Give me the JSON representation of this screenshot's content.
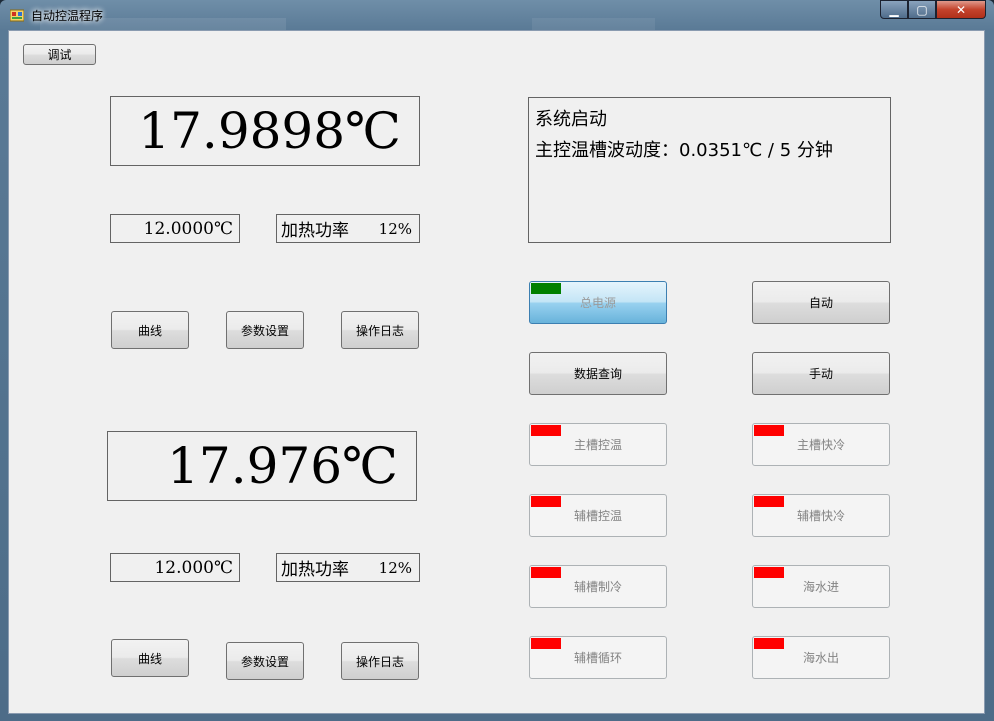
{
  "window": {
    "title": "自动控温程序",
    "controls": {
      "minimize": "▁",
      "maximize": "▢",
      "close": "✕"
    }
  },
  "toolbar": {
    "debug_label": "调试"
  },
  "channel1": {
    "temperature": "17.9898℃",
    "setpoint": "12.0000℃",
    "power_label": "加热功率",
    "power_value": "12%",
    "buttons": {
      "curve": "曲线",
      "params": "参数设置",
      "log": "操作日志"
    }
  },
  "channel2": {
    "temperature": "17.976℃",
    "setpoint": "12.000℃",
    "power_label": "加热功率",
    "power_value": "12%",
    "buttons": {
      "curve": "曲线",
      "params": "参数设置",
      "log": "操作日志"
    }
  },
  "status": {
    "lines": [
      "系统启动",
      "主控温槽波动度：0.0351℃ / 5 分钟"
    ]
  },
  "controls": {
    "main_power": "总电源",
    "auto": "自动",
    "data_query": "数据查询",
    "manual": "手动",
    "main_temp_control": "主槽控温",
    "main_fast_cool": "主槽快冷",
    "aux_temp_control": "辅槽控温",
    "aux_fast_cool": "辅槽快冷",
    "aux_cooling": "辅槽制冷",
    "seawater_in": "海水进",
    "aux_circulation": "辅槽循环",
    "seawater_out": "海水出"
  },
  "colors": {
    "indicator_off": "#ff0000",
    "indicator_on": "#008000",
    "form_background": "#f0f0f0"
  }
}
